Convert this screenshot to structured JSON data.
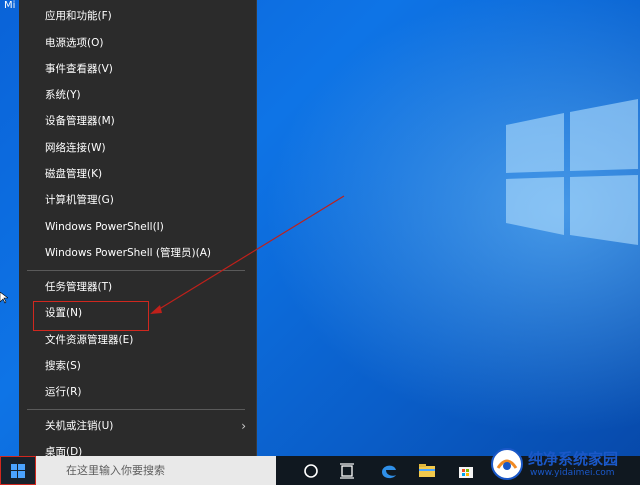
{
  "desktop": {
    "icon_label": "Mi"
  },
  "context_menu": {
    "items": [
      {
        "label": "应用和功能(F)"
      },
      {
        "label": "电源选项(O)"
      },
      {
        "label": "事件查看器(V)"
      },
      {
        "label": "系统(Y)"
      },
      {
        "label": "设备管理器(M)"
      },
      {
        "label": "网络连接(W)"
      },
      {
        "label": "磁盘管理(K)"
      },
      {
        "label": "计算机管理(G)"
      },
      {
        "label": "Windows PowerShell(I)"
      },
      {
        "label": "Windows PowerShell (管理员)(A)"
      },
      {
        "label": "任务管理器(T)"
      },
      {
        "label": "设置(N)"
      },
      {
        "label": "文件资源管理器(E)"
      },
      {
        "label": "搜索(S)"
      },
      {
        "label": "运行(R)"
      },
      {
        "label": "关机或注销(U)"
      },
      {
        "label": "桌面(D)"
      }
    ]
  },
  "taskbar": {
    "search_placeholder": "在这里输入你要搜索",
    "icons": [
      "cortana-icon",
      "task-view-icon",
      "edge-icon",
      "file-explorer-icon",
      "store-icon"
    ]
  },
  "watermark": {
    "title": "纯净系统家园",
    "url": "www.yidaimei.com"
  },
  "colors": {
    "menu_bg": "#2b2b2b",
    "highlight": "#d0281f",
    "desktop_blue": "#0a63d8"
  }
}
